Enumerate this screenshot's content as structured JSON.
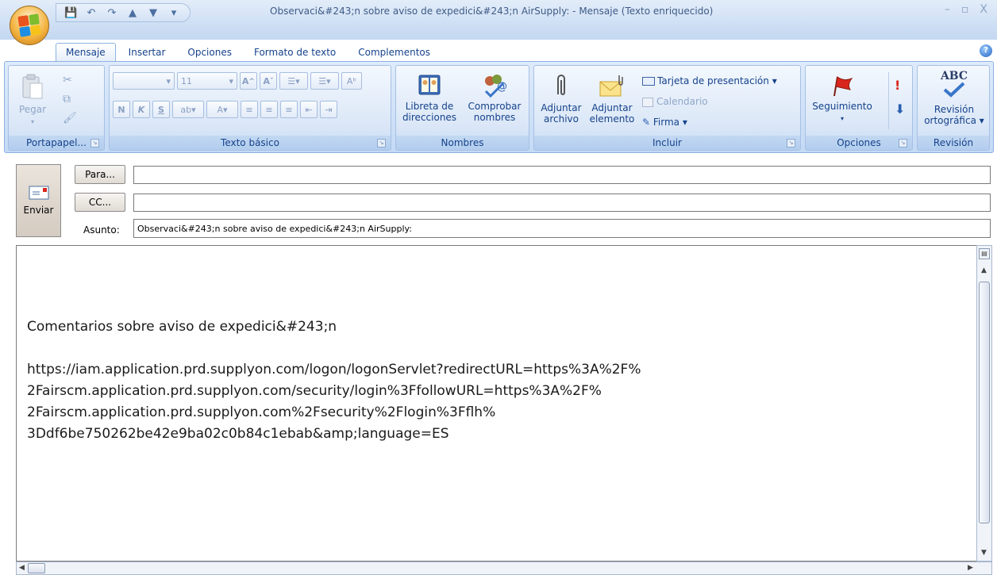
{
  "window": {
    "title": "Observaci&#243;n sobre aviso de expedici&#243;n AirSupply: - Mensaje (Texto enriquecido)",
    "controls": [
      "–",
      "▫",
      "X"
    ]
  },
  "tabs": [
    {
      "label": "Mensaje",
      "active": true
    },
    {
      "label": "Insertar"
    },
    {
      "label": "Opciones"
    },
    {
      "label": "Formato de texto"
    },
    {
      "label": "Complementos"
    }
  ],
  "ribbon": {
    "clipboard": {
      "group_label": "Portapapel...",
      "paste_label": "Pegar"
    },
    "basic_text": {
      "group_label": "Texto básico",
      "font_size": "11",
      "bold": "N",
      "italic": "K",
      "underline": "S"
    },
    "names": {
      "group_label": "Nombres",
      "address_book": "Libreta de direcciones",
      "address_book_l1": "Libreta de",
      "address_book_l2": "direcciones",
      "check_names_l1": "Comprobar",
      "check_names_l2": "nombres"
    },
    "include": {
      "group_label": "Incluir",
      "attach_file_l1": "Adjuntar",
      "attach_file_l2": "archivo",
      "attach_item_l1": "Adjuntar",
      "attach_item_l2": "elemento",
      "business_card": "Tarjeta de presentación",
      "calendar": "Calendario",
      "signature": "Firma"
    },
    "options": {
      "group_label": "Opciones",
      "follow_up": "Seguimiento"
    },
    "proofing": {
      "group_label": "Revisión",
      "spelling_l1": "Revisión",
      "spelling_l2": "ortográfica",
      "abc": "ABC"
    }
  },
  "compose": {
    "send_label": "Enviar",
    "to_button": "Para...",
    "cc_button": "CC...",
    "to_value": "",
    "cc_value": "",
    "subject_label": "Asunto:",
    "subject_value": "Observaci&#243;n sobre aviso de expedici&#243;n AirSupply:"
  },
  "body": {
    "line1": "Comentarios sobre aviso de expedici&#243;n",
    "url_lines": [
      "https://iam.application.prd.supplyon.com/logon/logonServlet?redirectURL=https%3A%2F%",
      "2Fairscm.application.prd.supplyon.com/security/login%3FfollowURL=https%3A%2F%",
      "2Fairscm.application.prd.supplyon.com%2Fsecurity%2Flogin%3Fflh%",
      "3Ddf6be750262be42e9ba02c0b84c1ebab&amp;language=ES"
    ]
  }
}
